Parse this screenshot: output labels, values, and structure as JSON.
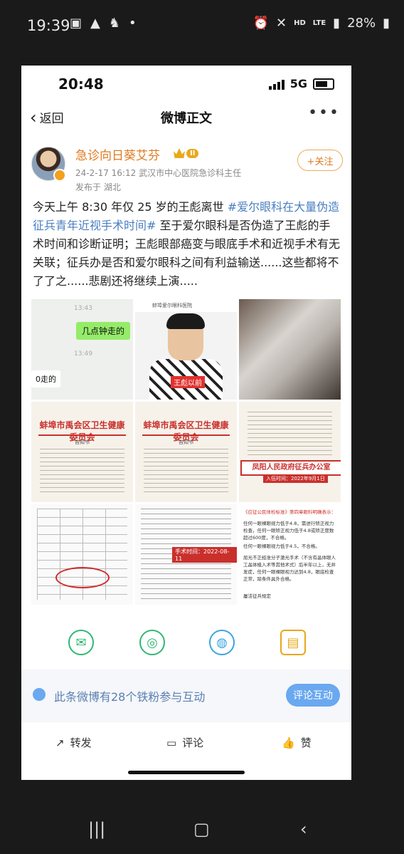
{
  "outer_status": {
    "time": "19:39",
    "battery": "28%",
    "net1": "HD",
    "net2": "LTE"
  },
  "inner_status": {
    "time": "20:48",
    "network": "5G"
  },
  "nav": {
    "back_label": "返回",
    "title": "微博正文",
    "more": "•••"
  },
  "author": {
    "name": "急诊向日葵艾芬",
    "level": "II",
    "timestamp": "24-2-17 16:12",
    "title": "武汉市中心医院急诊科主任",
    "location": "发布于 湖北",
    "follow_label": "+关注"
  },
  "post": {
    "text_before": "今天上午 8:30 年仅 25 岁的王彪离世 ",
    "hashtag": "#爱尔眼科在大量伪造征兵青年近视手术时间#",
    "text_after": "  至于爱尔眼科是否伪造了王彪的手术时间和诊断证明；王彪眼部癌变与眼底手术和近视手术有无关联；征兵办是否和爱尔眼科之间有利益输送......这些都将不了了之......悲剧还将继续上演....."
  },
  "images": {
    "img1": {
      "time1": "13:43",
      "bubble": "几点钟走的",
      "time2": "13:49",
      "bubble2": "0走的"
    },
    "img2": {
      "topbar": "蚌埠爱尔眼科医院",
      "label": "王彪以前"
    },
    "img4": {
      "header": "蚌埠市禹会区卫生健康委员会",
      "sub": "告知书"
    },
    "img5": {
      "header": "蚌埠市禹会区卫生健康委员会",
      "sub": "告知书"
    },
    "img6": {
      "stamp": "凤阳人民政府征兵办公室",
      "date": "入伍时间：2022年9月1日"
    },
    "img8": {
      "date": "手术时间：2022-08-11"
    },
    "img9": {
      "line1": "《应征公民体检标准》第四章眼科明确表示：",
      "line2": "任何一眼裸眼视力低于4.8，需进行矫正视力检查，任何一眼矫正视力低于4.8或矫正度数超过600度，不合格。",
      "line3": "任何一眼裸眼视力低于4.5，不合格。",
      "line4": "屈光不正经准分子激光手术（不含有晶体眼人工晶体植入术等其他术式）后半年以上，无并发症，任何一眼裸眼视力达到4.8，眼底检查正常，除条件具外合格。",
      "line5": "屡洁征兵规定"
    }
  },
  "share_icons": [
    "wechat-icon",
    "moments-icon",
    "qq-icon",
    "save-image-icon"
  ],
  "interaction": {
    "text": "此条微博有28个铁粉参与互动",
    "button": "评论互动"
  },
  "actions": {
    "repost": "转发",
    "comment": "评论",
    "like": "赞"
  },
  "colors": {
    "accent_orange": "#e07a1f",
    "hashtag_blue": "#4a7fc1",
    "button_blue": "#6aa8f0"
  }
}
